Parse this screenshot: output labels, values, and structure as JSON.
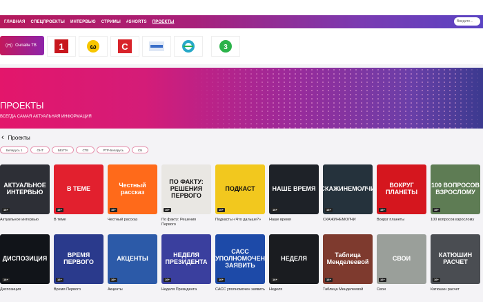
{
  "nav": {
    "items": [
      "ГЛАВНАЯ",
      "СПЕЦПРОЕКТЫ",
      "ИНТЕРВЬЮ",
      "СТРИМЫ",
      "#SHORTS",
      "ПРОЕКТЫ"
    ],
    "search_placeholder": "Введите..."
  },
  "channels": {
    "online_label": "Онлайн ТВ",
    "logos": [
      "Беларусь 1",
      "ОНТ",
      "Беларусь 24",
      "СТВ",
      "РТР-Беларусь",
      "Беларусь 5",
      "Беларусь 3"
    ]
  },
  "hero": {
    "title": "ПРОЕКТЫ",
    "subtitle": "ВСЕГДА САМАЯ АКТУАЛЬНАЯ ИНФОРМАЦИЯ"
  },
  "section": {
    "back": "‹",
    "title": "Проекты"
  },
  "filters": [
    "Беларусь 1",
    "ОНТ",
    "БЕЛТА",
    "СТВ",
    "РТР-Беларусь",
    "СБ"
  ],
  "row1": [
    {
      "thumb": "АКТУАЛЬНОЕ ИНТЕРВЬЮ",
      "caption": "Актуальное интервью",
      "age": "16+",
      "bg": "#2d2f36"
    },
    {
      "thumb": "В ТЕМЕ",
      "caption": "В теме",
      "age": "16+",
      "bg": "#e2202e"
    },
    {
      "thumb": "Честный рассказ",
      "caption": "Честный рассказ",
      "age": "16+",
      "bg": "#ff6a1a"
    },
    {
      "thumb": "ПО ФАКТУ: РЕШЕНИЯ ПЕРВОГО",
      "caption": "По факту: Решения Первого",
      "age": "16+",
      "bg": "#e9e7e3"
    },
    {
      "thumb": "ПОДКАСТ",
      "caption": "Подкасты «Что дальше?»",
      "age": "16+",
      "bg": "#f2c81e"
    },
    {
      "thumb": "НАШЕ ВРЕМЯ",
      "caption": "Наше время",
      "age": "16+",
      "bg": "#1e2228"
    },
    {
      "thumb": "СКАЖИНЕМОЛЧИ",
      "caption": "СКАЖИНЕМОЛЧИ",
      "age": "16+",
      "bg": "#25323c"
    },
    {
      "thumb": "ВОКРУГ ПЛАНЕТЫ",
      "caption": "Вокруг планеты",
      "age": "16+",
      "bg": "#d5161e"
    },
    {
      "thumb": "100 ВОПРОСОВ ВЗРОСЛОМУ",
      "caption": "100 вопросов взрослому",
      "age": "16+",
      "bg": "#5e7c54"
    }
  ],
  "row2": [
    {
      "thumb": "ДИСПОЗИЦИЯ",
      "caption": "Диспозиция",
      "age": "16+",
      "bg": "#111419"
    },
    {
      "thumb": "ВРЕМЯ ПЕРВОГО",
      "caption": "Время Первого",
      "age": "16+",
      "bg": "#2a3a8c"
    },
    {
      "thumb": "АКЦЕНТЫ",
      "caption": "Акценты",
      "age": "16+",
      "bg": "#2c5aa8"
    },
    {
      "thumb": "НЕДЕЛЯ ПРЕЗИДЕНТА",
      "caption": "Неделя Президента",
      "age": "16+",
      "bg": "#3a3f9e"
    },
    {
      "thumb": "САСС УПОЛНОМОЧЕН ЗАЯВИТЬ",
      "caption": "САСС уполномочен заявить",
      "age": "16+",
      "bg": "#1d4aa8"
    },
    {
      "thumb": "НЕДЕЛЯ",
      "caption": "Неделя",
      "age": "16+",
      "bg": "#1a1c20"
    },
    {
      "thumb": "Таблица Менделеевой",
      "caption": "Таблица Менделеевой",
      "age": "16+",
      "bg": "#7e3a2e"
    },
    {
      "thumb": "СВОИ",
      "caption": "Свои",
      "age": "16+",
      "bg": "#9a9f9a"
    },
    {
      "thumb": "КАТЮШИН РАСЧЕТ",
      "caption": "Катюшин расчет",
      "age": "16+",
      "bg": "#4a4d52"
    }
  ]
}
